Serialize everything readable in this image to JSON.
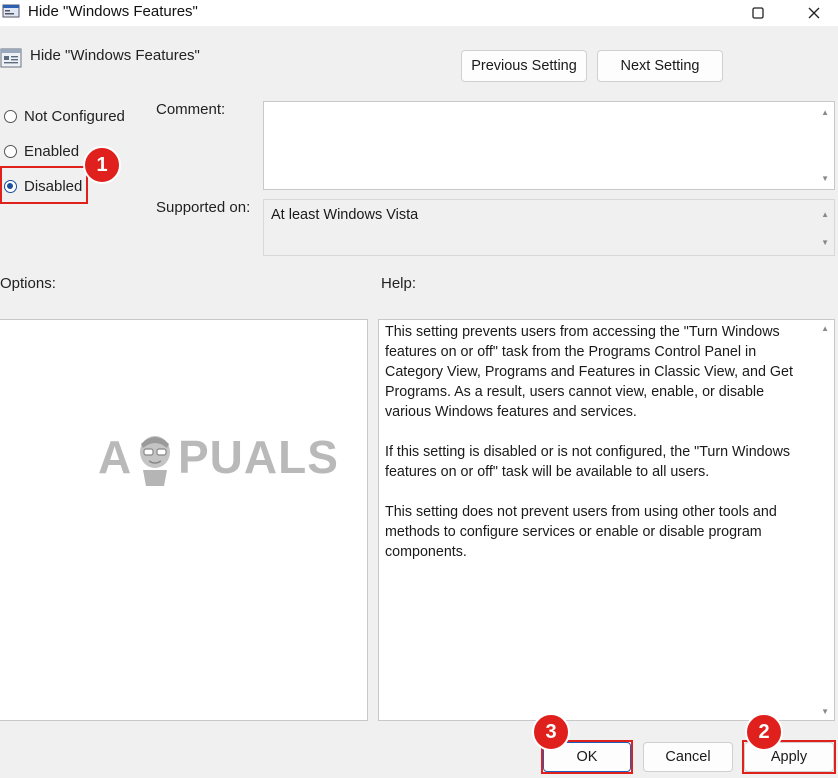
{
  "window": {
    "title": "Hide \"Windows Features\"",
    "minimize_glyph": "—",
    "maximize_glyph": "☐",
    "close_glyph": "✕"
  },
  "header": {
    "policy_title": "Hide \"Windows Features\""
  },
  "nav": {
    "previous_label": "Previous Setting",
    "next_label": "Next Setting"
  },
  "state": {
    "options": [
      {
        "label": "Not Configured",
        "selected": false
      },
      {
        "label": "Enabled",
        "selected": false
      },
      {
        "label": "Disabled",
        "selected": true
      }
    ]
  },
  "comment": {
    "label": "Comment:",
    "value": ""
  },
  "supported": {
    "label": "Supported on:",
    "value": "At least Windows Vista"
  },
  "options_label": "Options:",
  "help": {
    "label": "Help:",
    "paragraphs": [
      "This setting prevents users from accessing the \"Turn Windows features on or off\" task from the Programs Control Panel in Category View, Programs and Features in Classic View, and Get Programs.  As a result, users cannot view, enable, or disable various Windows features and services.",
      "If this setting is disabled or is not configured, the \"Turn Windows features on or off\" task will be available to all users.",
      "This setting does not prevent users from using other tools and methods to configure services or enable or disable program components."
    ]
  },
  "footer": {
    "ok_label": "OK",
    "cancel_label": "Cancel",
    "apply_label": "Apply"
  },
  "annotations": {
    "step1": "1",
    "step2": "2",
    "step3": "3",
    "color": "#e0201c"
  },
  "watermark": {
    "text_left": "A",
    "text_right": "PUALS"
  }
}
